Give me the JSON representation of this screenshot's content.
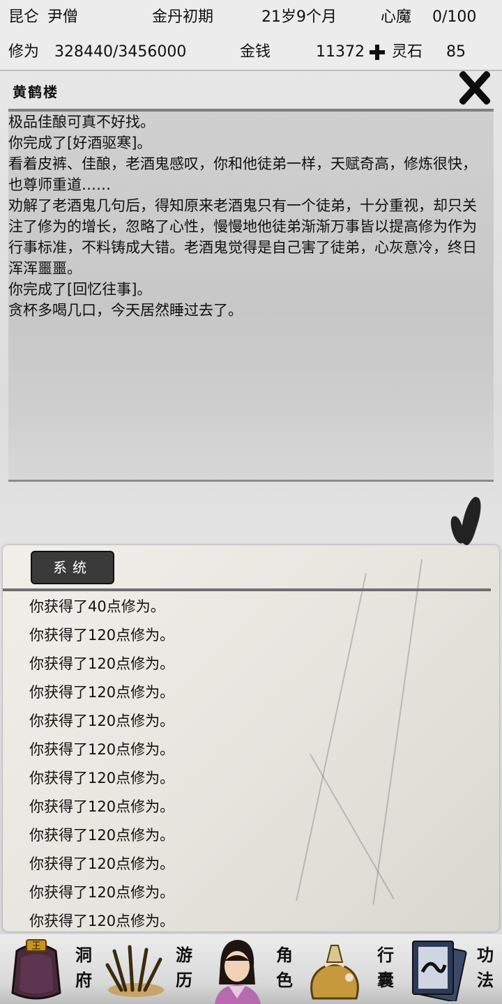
{
  "header": {
    "sect": "昆仑",
    "name": "尹僧",
    "realm": "金丹初期",
    "age": "21岁9个月",
    "heart_demon_label": "心魔",
    "heart_demon_value": "0/100",
    "cultivation_label": "修为",
    "cultivation_value": "328440/3456000",
    "money_label": "金钱",
    "money_value": "11372",
    "spirit_stone_label": "灵石",
    "spirit_stone_value": "85"
  },
  "event": {
    "title": "黄鹤楼",
    "lines": [
      "极品佳酿可真不好找。",
      "你完成了[好酒驱寒]。",
      "看着皮裤、佳酿，老酒鬼感叹，你和他徒弟一样，天赋奇高，修炼很快，也尊师重道……",
      "劝解了老酒鬼几句后，得知原来老酒鬼只有一个徒弟，十分重视，却只关注了修为的增长，忽略了心性，慢慢地他徒弟渐渐万事皆以提高修为作为行事标准，不料铸成大错。老酒鬼觉得是自己害了徒弟，心灰意冷，终日浑浑噩噩。",
      "你完成了[回忆往事]。",
      "贪杯多喝几口，今天居然睡过去了。"
    ]
  },
  "log": {
    "tab_label": "系统",
    "items": [
      "你获得了40点修为。",
      "你获得了120点修为。",
      "你获得了120点修为。",
      "你获得了120点修为。",
      "你获得了120点修为。",
      "你获得了120点修为。",
      "你获得了120点修为。",
      "你获得了120点修为。",
      "你获得了120点修为。",
      "你获得了120点修为。",
      "你获得了120点修为。",
      "你获得了120点修为。"
    ]
  },
  "nav": {
    "cave": [
      "洞",
      "府"
    ],
    "travel": [
      "游",
      "历"
    ],
    "role": [
      "角",
      "色"
    ],
    "bag": [
      "行",
      "囊"
    ],
    "skill": [
      "功",
      "法"
    ],
    "cave_badge": "王"
  }
}
